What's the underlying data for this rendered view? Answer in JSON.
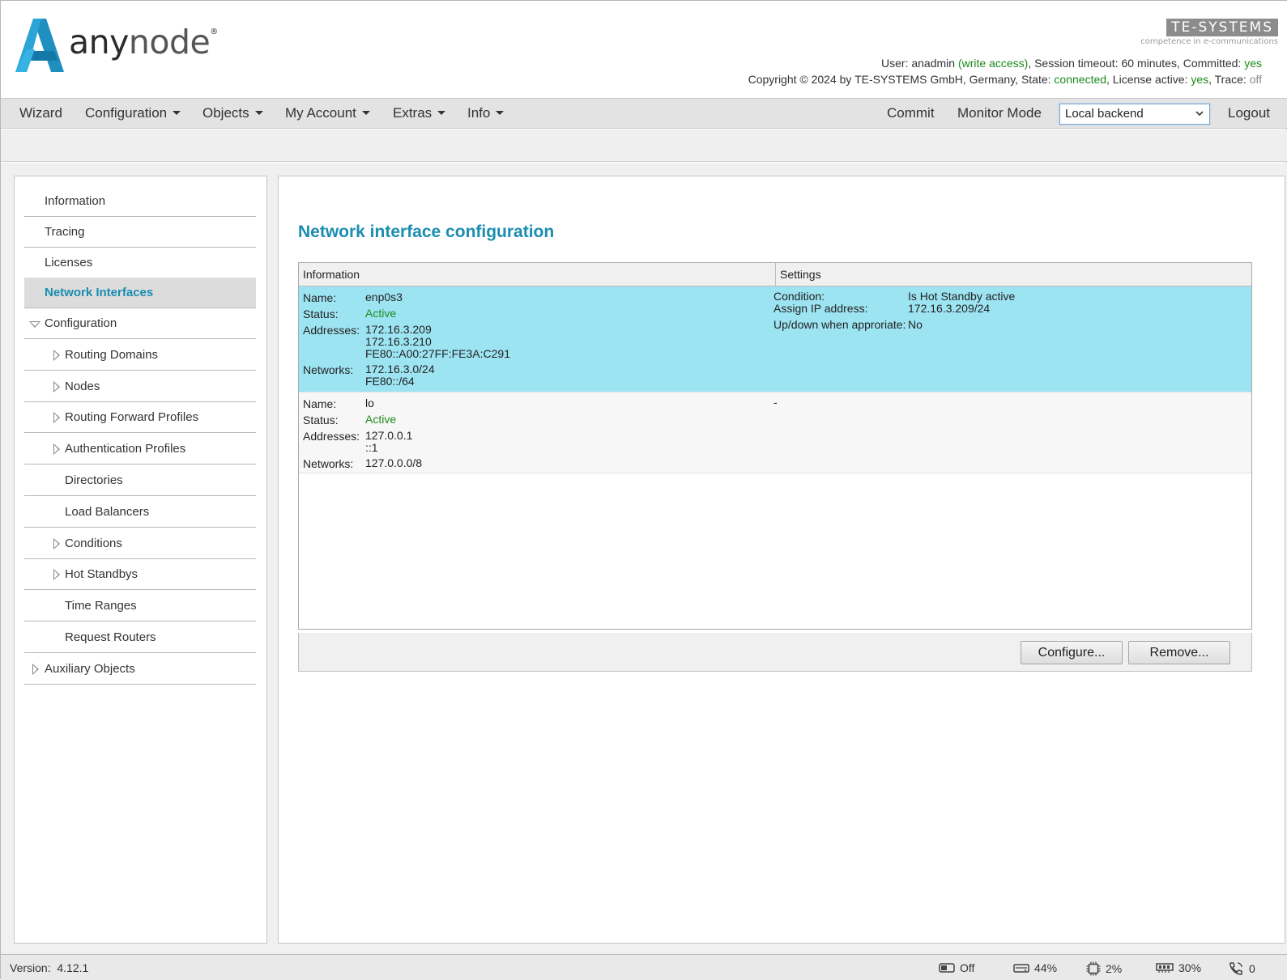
{
  "brand": {
    "product_name_prefix": "any",
    "product_name_suffix": "node",
    "registered": "®",
    "vendor_logo_text": "TE-SYSTEMS",
    "vendor_tagline": "competence in e-communications"
  },
  "header": {
    "user_label": "User:",
    "user_name": "anadmin",
    "access": "(write access)",
    "session_label": ", Session timeout: 60 minutes, Committed:",
    "committed": "yes",
    "copyright": "Copyright © 2024 by TE-SYSTEMS GmbH, Germany, State:",
    "state": "connected",
    "license_label": ", License active:",
    "license": "yes",
    "trace_label": ", Trace:",
    "trace": "off"
  },
  "menu": {
    "wizard": "Wizard",
    "configuration": "Configuration",
    "objects": "Objects",
    "my_account": "My Account",
    "extras": "Extras",
    "info": "Info",
    "commit": "Commit",
    "monitor_mode": "Monitor Mode",
    "backend_selected": "Local backend",
    "logout": "Logout"
  },
  "sidebar": {
    "items": [
      {
        "label": "Information"
      },
      {
        "label": "Tracing"
      },
      {
        "label": "Licenses"
      },
      {
        "label": "Network Interfaces"
      },
      {
        "label": "Configuration"
      },
      {
        "label": "Routing Domains"
      },
      {
        "label": "Nodes"
      },
      {
        "label": "Routing Forward Profiles"
      },
      {
        "label": "Authentication Profiles"
      },
      {
        "label": "Directories"
      },
      {
        "label": "Load Balancers"
      },
      {
        "label": "Conditions"
      },
      {
        "label": "Hot Standbys"
      },
      {
        "label": "Time Ranges"
      },
      {
        "label": "Request Routers"
      },
      {
        "label": "Auxiliary Objects"
      }
    ]
  },
  "main": {
    "title": "Network interface configuration",
    "columns": [
      "Information",
      "Settings"
    ],
    "labels": {
      "name": "Name:",
      "status": "Status:",
      "addresses": "Addresses:",
      "networks": "Networks:",
      "condition": "Condition:",
      "assign_ip": "Assign IP address:",
      "updown": "Up/down when approriate:"
    },
    "rows": [
      {
        "name": "enp0s3",
        "status": "Active",
        "addresses": [
          "172.16.3.209",
          "172.16.3.210",
          "FE80::A00:27FF:FE3A:C291"
        ],
        "networks": [
          "172.16.3.0/24",
          "FE80::/64"
        ],
        "condition": "Is Hot Standby active",
        "assign_ip": "172.16.3.209/24",
        "updown": "No"
      },
      {
        "name": "lo",
        "status": "Active",
        "addresses": [
          "127.0.0.1",
          "::1"
        ],
        "networks": [
          "127.0.0.0/8"
        ],
        "settings": "-"
      }
    ],
    "buttons": {
      "configure": "Configure...",
      "remove": "Remove..."
    }
  },
  "statusbar": {
    "version_label": "Version:",
    "version": "4.12.1",
    "monitor": "Off",
    "disk": "44%",
    "cpu": "2%",
    "memory": "30%",
    "calls": "0"
  }
}
